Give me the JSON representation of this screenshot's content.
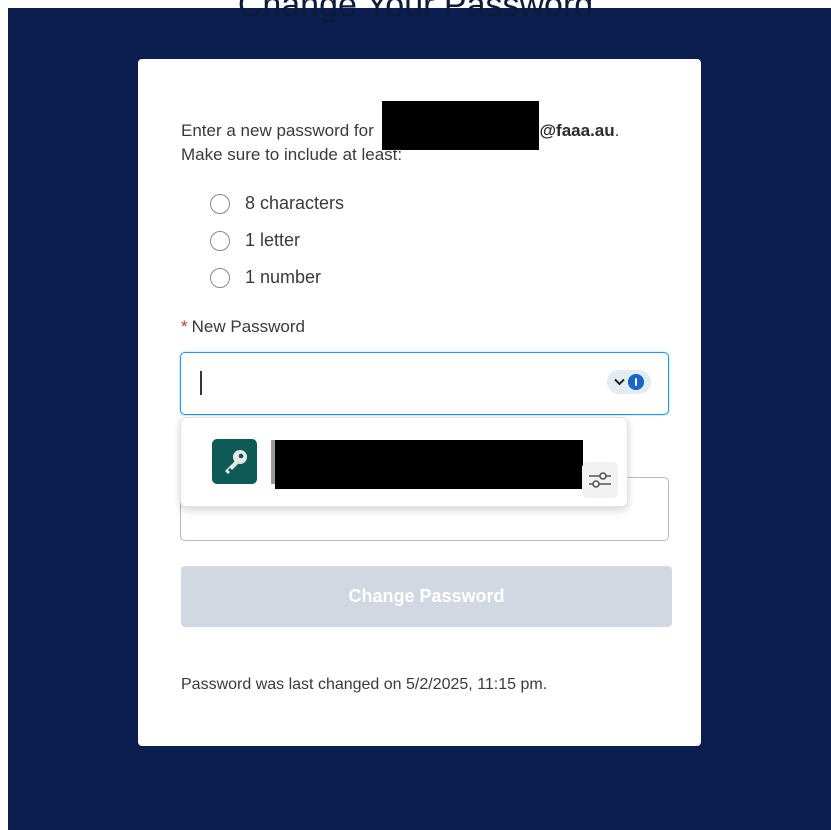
{
  "page": {
    "title": "Change Your Password"
  },
  "form": {
    "intro_prefix": "Enter a new password for ",
    "email_domain": "@faaa.au",
    "intro_suffix": ".",
    "instructions": "Make sure to include at least:",
    "requirements": [
      {
        "label": "8 characters"
      },
      {
        "label": "1 letter"
      },
      {
        "label": "1 number"
      }
    ],
    "new_password": {
      "required_marker": "*",
      "label": "New Password",
      "value": ""
    },
    "confirm_password": {
      "value": ""
    },
    "submit_label": "Change Password",
    "last_changed": "Password was last changed on 5/2/2025, 11:15 pm."
  },
  "password_manager": {
    "badge_icon": "chevron-down-icon",
    "brand_icon": "1password-icon",
    "suggestion_icon": "key-icon",
    "settings_icon": "sliders-icon",
    "suggestion_redacted": true
  },
  "colors": {
    "backdrop": "#0b1e4f",
    "focus_border": "#1b96ff",
    "button_disabled": "#d2d8e1",
    "key_tile": "#0e5a57",
    "required": "#c23934"
  }
}
